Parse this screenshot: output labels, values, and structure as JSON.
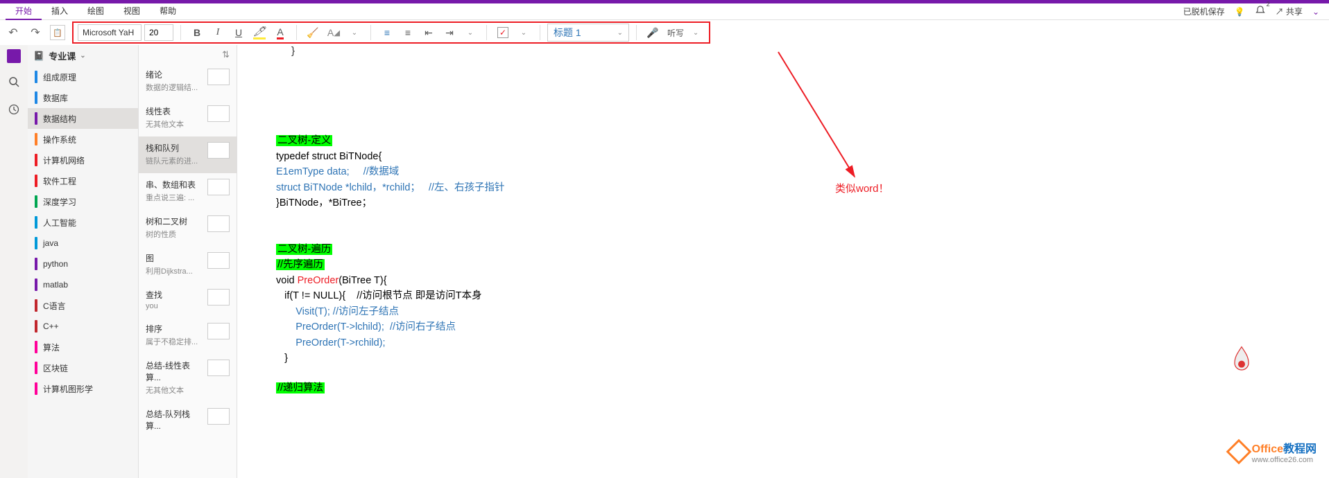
{
  "tabs": {
    "items": [
      "开始",
      "插入",
      "绘图",
      "视图",
      "帮助"
    ],
    "active": 0
  },
  "topright": {
    "status": "已脱机保存",
    "share": "共享",
    "notif_count": "2"
  },
  "ribbon": {
    "font_name": "Microsoft YaH",
    "font_size": "20",
    "style": "标题 1",
    "dictate": "听写"
  },
  "notebook_header": "专业课",
  "sections": [
    {
      "label": "组成原理",
      "color": "#1e88e5"
    },
    {
      "label": "数据库",
      "color": "#1e88e5"
    },
    {
      "label": "数据结构",
      "color": "#7719AA",
      "sel": true
    },
    {
      "label": "操作系统",
      "color": "#ff7f27"
    },
    {
      "label": "计算机网络",
      "color": "#ed1c24"
    },
    {
      "label": "软件工程",
      "color": "#ed1c24"
    },
    {
      "label": "深度学习",
      "color": "#00a651"
    },
    {
      "label": "人工智能",
      "color": "#0099d8"
    },
    {
      "label": "java",
      "color": "#0099d8"
    },
    {
      "label": "python",
      "color": "#7719AA"
    },
    {
      "label": "matlab",
      "color": "#7719AA"
    },
    {
      "label": "C语言",
      "color": "#c1272d"
    },
    {
      "label": "C++",
      "color": "#c1272d"
    },
    {
      "label": "算法",
      "color": "#ff0099"
    },
    {
      "label": "区块链",
      "color": "#ff0099"
    },
    {
      "label": "计算机图形学",
      "color": "#ff0099"
    }
  ],
  "pages": [
    {
      "title": "绪论",
      "sub": "数据的逻辑结..."
    },
    {
      "title": "线性表",
      "sub": "无其他文本"
    },
    {
      "title": "栈和队列",
      "sub": "链队元素的进...",
      "sel": true
    },
    {
      "title": "串、数组和表",
      "sub": "重点说三遍: ..."
    },
    {
      "title": "树和二叉树",
      "sub": "树的性质"
    },
    {
      "title": "图",
      "sub": "利用Dijkstra..."
    },
    {
      "title": "查找",
      "sub": "you"
    },
    {
      "title": "排序",
      "sub": "属于不稳定排..."
    },
    {
      "title": "总结-线性表算...",
      "sub": "无其他文本"
    },
    {
      "title": "总结-队列栈算...",
      "sub": ""
    }
  ],
  "content": {
    "brace": "}",
    "h1": "二叉树-定义",
    "l1": "typedef struct BiTNode{",
    "l2a": "E1emType data;",
    "l2b": "//数据域",
    "l3a": "struct BiTNode *lchild，*rchild；",
    "l3b": "//左、右孩子指针",
    "l4": "}BiTNode，*BiTree；",
    "h2": "二叉树-遍历",
    "h2b": "//先序遍历",
    "l5a": "void ",
    "l5b": "PreOrder",
    "l5c": "(BiTree T){",
    "l6a": "if(T != NULL){",
    "l6b": "//访问根节点  即是访问T本身",
    "l7a": "Visit(T);",
    "l7b": " //访问左子结点",
    "l8a": "PreOrder(T->lchild);",
    "l8b": "//访问右子结点",
    "l9": "PreOrder(T->rchild);",
    "l10": "}",
    "h3": "//递归算法"
  },
  "annotation": "类似word！",
  "watermark": {
    "brand1": "Office",
    "brand2": "教程网",
    "url": "www.office26.com"
  }
}
